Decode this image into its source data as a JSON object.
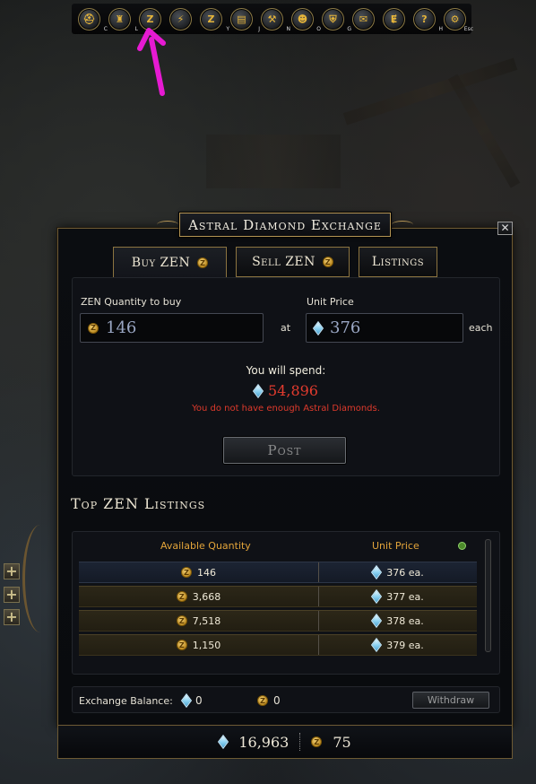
{
  "hotbar": {
    "buttons": [
      {
        "icon": "helmet-icon",
        "glyph": "⛑",
        "key": "C"
      },
      {
        "icon": "castle-icon",
        "glyph": "♜",
        "key": "L"
      },
      {
        "icon": "zen-market-icon",
        "glyph": "Z",
        "key": ""
      },
      {
        "icon": "power-icon",
        "glyph": "⚡",
        "key": ""
      },
      {
        "icon": "zen-icon",
        "glyph": "Z",
        "key": "Y"
      },
      {
        "icon": "journal-icon",
        "glyph": "▤",
        "key": "J"
      },
      {
        "icon": "crafting-icon",
        "glyph": "⚒",
        "key": "N"
      },
      {
        "icon": "party-icon",
        "glyph": "☻",
        "key": "O"
      },
      {
        "icon": "guild-shield-icon",
        "glyph": "⛨",
        "key": "G"
      },
      {
        "icon": "mail-icon",
        "glyph": "✉",
        "key": ""
      },
      {
        "icon": "exchange-icon",
        "glyph": "Ɇ",
        "key": ""
      },
      {
        "icon": "help-icon",
        "glyph": "?",
        "key": "H"
      },
      {
        "icon": "settings-gear-icon",
        "glyph": "⚙",
        "key": "Esc"
      }
    ]
  },
  "window": {
    "title": "Astral Diamond Exchange",
    "close_glyph": "✕",
    "tabs": {
      "buy": "Buy ZEN",
      "sell": "Sell ZEN",
      "listings": "Listings"
    }
  },
  "buy": {
    "quantity_label": "ZEN Quantity to buy",
    "quantity_value": "146",
    "at": "at",
    "price_label": "Unit Price",
    "price_value": "376",
    "each": "each",
    "spend_label": "You will spend:",
    "spend_value": "54,896",
    "warning": "You do not have enough Astral Diamonds.",
    "post": "Post"
  },
  "listings": {
    "title": "Top ZEN Listings",
    "col_quantity": "Available Quantity",
    "col_price": "Unit Price",
    "rows": [
      {
        "qty": "146",
        "price": "376 ea."
      },
      {
        "qty": "3,668",
        "price": "377 ea."
      },
      {
        "qty": "7,518",
        "price": "378 ea."
      },
      {
        "qty": "1,150",
        "price": "379 ea."
      }
    ]
  },
  "balance": {
    "label": "Exchange Balance:",
    "diamonds": "0",
    "zen": "0",
    "withdraw": "Withdraw"
  },
  "wallet": {
    "diamonds": "16,963",
    "zen": "75"
  },
  "zen_glyph": "Z",
  "side_plus": "+",
  "colors": {
    "gold_accent": "#e2a43a",
    "warning_red": "#e33b2e",
    "annotation_magenta": "#e61ad2"
  }
}
